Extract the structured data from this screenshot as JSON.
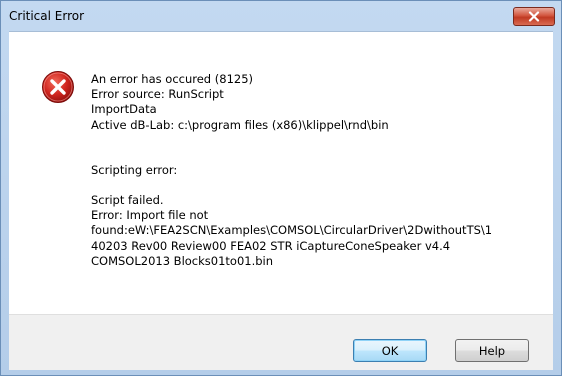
{
  "window": {
    "title": "Critical Error"
  },
  "icons": {
    "title_close": "close-icon",
    "message": "error-icon"
  },
  "colors": {
    "close_button": "#c03a23",
    "error_icon": "#c8181c"
  },
  "message": {
    "line1": "An error has occured (8125)",
    "line2": "Error source: RunScript",
    "line3": "ImportData",
    "line4": "Active dB-Lab: c:\\program files (x86)\\klippel\\rnd\\bin",
    "line5": "Scripting error:",
    "line6": "Script failed.",
    "line7": "Error: Import file not",
    "line8": "found:eW:\\FEA2SCN\\Examples\\COMSOL\\CircularDriver\\2DwithoutTS\\1",
    "line9": "40203 Rev00 Review00 FEA02 STR iCaptureConeSpeaker v4.4",
    "line10": "COMSOL2013 Blocks01to01.bin"
  },
  "buttons": {
    "ok": "OK",
    "help": "Help"
  }
}
